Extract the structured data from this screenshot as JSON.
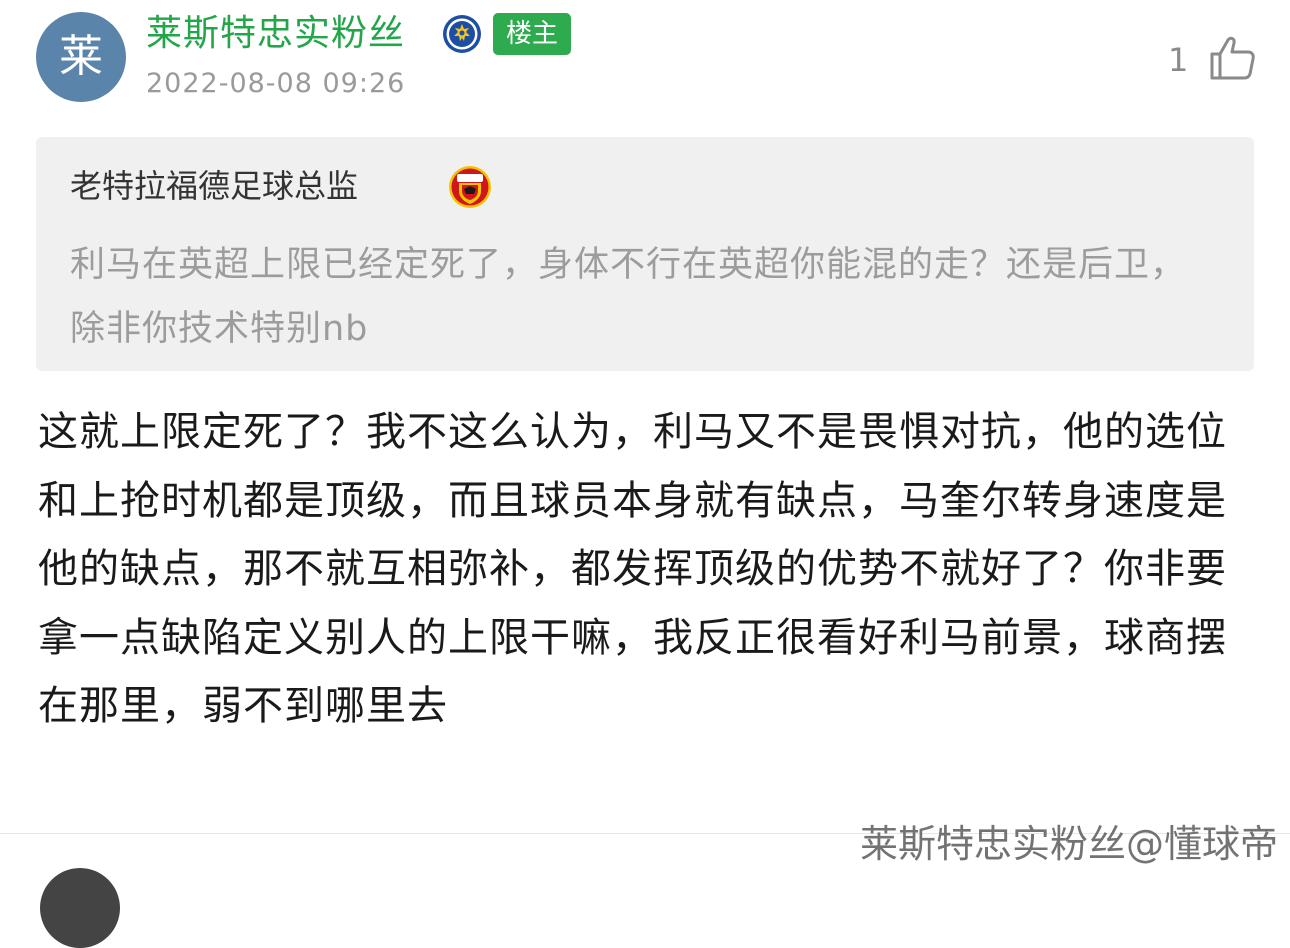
{
  "post": {
    "avatar_char": "莱",
    "username": "莱斯特忠实粉丝",
    "owner_badge": "楼主",
    "timestamp": "2022-08-08 09:26",
    "like_count": "1"
  },
  "quote": {
    "author": "老特拉福德足球总监",
    "text": "利马在英超上限已经定死了，身体不行在英超你能混的走？还是后卫，除非你技术特别nb"
  },
  "reply": {
    "text": "这就上限定死了？我不这么认为，利马又不是畏惧对抗，他的选位和上抢时机都是顶级，而且球员本身就有缺点，马奎尔转身速度是他的缺点，那不就互相弥补，都发挥顶级的优势不就好了？你非要拿一点缺陷定义别人的上限干嘛，我反正很看好利马前景，球商摆在那里，弱不到哪里去"
  },
  "watermark": "莱斯特忠实粉丝@懂球帝",
  "colors": {
    "username_green": "#23a54a",
    "badge_green": "#2eaa4f",
    "avatar_blue": "#5b84ab",
    "quote_bg": "#f0f0f0"
  },
  "icons": {
    "team_badge": "leicester-crest-icon",
    "quote_badge": "manchester-united-crest-icon",
    "like": "thumbs-up-icon"
  }
}
